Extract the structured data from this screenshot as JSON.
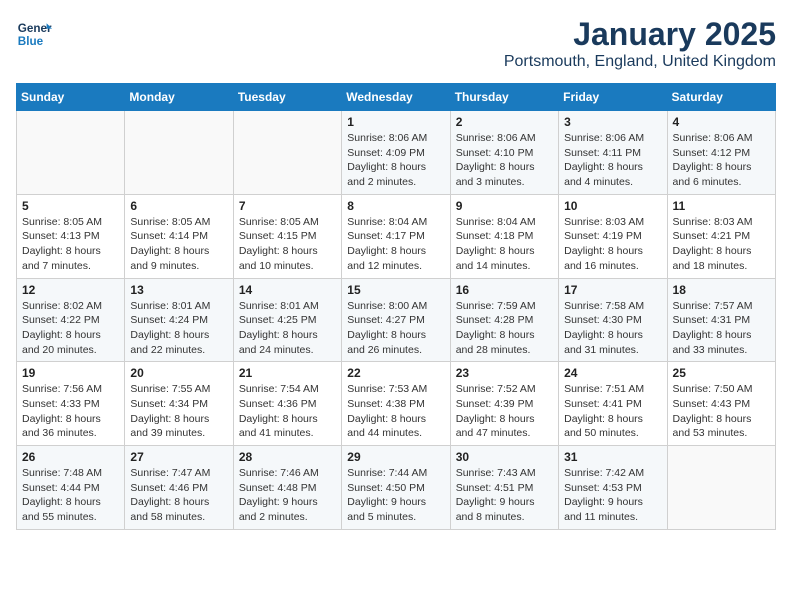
{
  "header": {
    "logo_general": "General",
    "logo_blue": "Blue",
    "month": "January 2025",
    "location": "Portsmouth, England, United Kingdom"
  },
  "days_of_week": [
    "Sunday",
    "Monday",
    "Tuesday",
    "Wednesday",
    "Thursday",
    "Friday",
    "Saturday"
  ],
  "weeks": [
    [
      {
        "day": "",
        "info": ""
      },
      {
        "day": "",
        "info": ""
      },
      {
        "day": "",
        "info": ""
      },
      {
        "day": "1",
        "info": "Sunrise: 8:06 AM\nSunset: 4:09 PM\nDaylight: 8 hours and 2 minutes."
      },
      {
        "day": "2",
        "info": "Sunrise: 8:06 AM\nSunset: 4:10 PM\nDaylight: 8 hours and 3 minutes."
      },
      {
        "day": "3",
        "info": "Sunrise: 8:06 AM\nSunset: 4:11 PM\nDaylight: 8 hours and 4 minutes."
      },
      {
        "day": "4",
        "info": "Sunrise: 8:06 AM\nSunset: 4:12 PM\nDaylight: 8 hours and 6 minutes."
      }
    ],
    [
      {
        "day": "5",
        "info": "Sunrise: 8:05 AM\nSunset: 4:13 PM\nDaylight: 8 hours and 7 minutes."
      },
      {
        "day": "6",
        "info": "Sunrise: 8:05 AM\nSunset: 4:14 PM\nDaylight: 8 hours and 9 minutes."
      },
      {
        "day": "7",
        "info": "Sunrise: 8:05 AM\nSunset: 4:15 PM\nDaylight: 8 hours and 10 minutes."
      },
      {
        "day": "8",
        "info": "Sunrise: 8:04 AM\nSunset: 4:17 PM\nDaylight: 8 hours and 12 minutes."
      },
      {
        "day": "9",
        "info": "Sunrise: 8:04 AM\nSunset: 4:18 PM\nDaylight: 8 hours and 14 minutes."
      },
      {
        "day": "10",
        "info": "Sunrise: 8:03 AM\nSunset: 4:19 PM\nDaylight: 8 hours and 16 minutes."
      },
      {
        "day": "11",
        "info": "Sunrise: 8:03 AM\nSunset: 4:21 PM\nDaylight: 8 hours and 18 minutes."
      }
    ],
    [
      {
        "day": "12",
        "info": "Sunrise: 8:02 AM\nSunset: 4:22 PM\nDaylight: 8 hours and 20 minutes."
      },
      {
        "day": "13",
        "info": "Sunrise: 8:01 AM\nSunset: 4:24 PM\nDaylight: 8 hours and 22 minutes."
      },
      {
        "day": "14",
        "info": "Sunrise: 8:01 AM\nSunset: 4:25 PM\nDaylight: 8 hours and 24 minutes."
      },
      {
        "day": "15",
        "info": "Sunrise: 8:00 AM\nSunset: 4:27 PM\nDaylight: 8 hours and 26 minutes."
      },
      {
        "day": "16",
        "info": "Sunrise: 7:59 AM\nSunset: 4:28 PM\nDaylight: 8 hours and 28 minutes."
      },
      {
        "day": "17",
        "info": "Sunrise: 7:58 AM\nSunset: 4:30 PM\nDaylight: 8 hours and 31 minutes."
      },
      {
        "day": "18",
        "info": "Sunrise: 7:57 AM\nSunset: 4:31 PM\nDaylight: 8 hours and 33 minutes."
      }
    ],
    [
      {
        "day": "19",
        "info": "Sunrise: 7:56 AM\nSunset: 4:33 PM\nDaylight: 8 hours and 36 minutes."
      },
      {
        "day": "20",
        "info": "Sunrise: 7:55 AM\nSunset: 4:34 PM\nDaylight: 8 hours and 39 minutes."
      },
      {
        "day": "21",
        "info": "Sunrise: 7:54 AM\nSunset: 4:36 PM\nDaylight: 8 hours and 41 minutes."
      },
      {
        "day": "22",
        "info": "Sunrise: 7:53 AM\nSunset: 4:38 PM\nDaylight: 8 hours and 44 minutes."
      },
      {
        "day": "23",
        "info": "Sunrise: 7:52 AM\nSunset: 4:39 PM\nDaylight: 8 hours and 47 minutes."
      },
      {
        "day": "24",
        "info": "Sunrise: 7:51 AM\nSunset: 4:41 PM\nDaylight: 8 hours and 50 minutes."
      },
      {
        "day": "25",
        "info": "Sunrise: 7:50 AM\nSunset: 4:43 PM\nDaylight: 8 hours and 53 minutes."
      }
    ],
    [
      {
        "day": "26",
        "info": "Sunrise: 7:48 AM\nSunset: 4:44 PM\nDaylight: 8 hours and 55 minutes."
      },
      {
        "day": "27",
        "info": "Sunrise: 7:47 AM\nSunset: 4:46 PM\nDaylight: 8 hours and 58 minutes."
      },
      {
        "day": "28",
        "info": "Sunrise: 7:46 AM\nSunset: 4:48 PM\nDaylight: 9 hours and 2 minutes."
      },
      {
        "day": "29",
        "info": "Sunrise: 7:44 AM\nSunset: 4:50 PM\nDaylight: 9 hours and 5 minutes."
      },
      {
        "day": "30",
        "info": "Sunrise: 7:43 AM\nSunset: 4:51 PM\nDaylight: 9 hours and 8 minutes."
      },
      {
        "day": "31",
        "info": "Sunrise: 7:42 AM\nSunset: 4:53 PM\nDaylight: 9 hours and 11 minutes."
      },
      {
        "day": "",
        "info": ""
      }
    ]
  ]
}
